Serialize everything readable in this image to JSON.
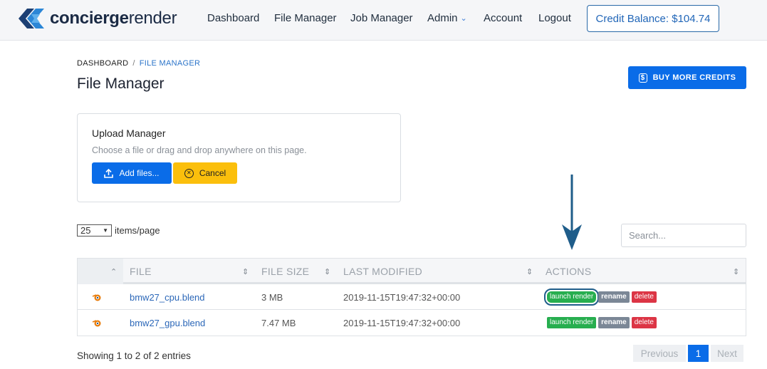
{
  "header": {
    "logo_bold": "concierge",
    "logo_light": "render",
    "nav": [
      "Dashboard",
      "File Manager",
      "Job Manager",
      "Admin",
      "Account",
      "Logout"
    ],
    "credit_balance": "Credit Balance: $104.74"
  },
  "breadcrumb": {
    "root": "DASHBOARD",
    "separator": "/",
    "current": "FILE MANAGER"
  },
  "page_title": "File Manager",
  "buy_button": {
    "icon": "$",
    "label": "BUY MORE CREDITS"
  },
  "upload": {
    "title": "Upload Manager",
    "hint": "Choose a file or drag and drop anywhere on this page.",
    "add_label": "Add files...",
    "cancel_label": "Cancel"
  },
  "table_controls": {
    "per_page_value": "25",
    "per_page_label": "items/page",
    "search_placeholder": "Search..."
  },
  "table": {
    "columns": [
      "FILE",
      "FILE SIZE",
      "LAST MODIFIED",
      "ACTIONS"
    ],
    "rows": [
      {
        "file": "bmw27_cpu.blend",
        "size": "3 MB",
        "modified": "2019-11-15T19:47:32+00:00"
      },
      {
        "file": "bmw27_gpu.blend",
        "size": "7.47 MB",
        "modified": "2019-11-15T19:47:32+00:00"
      }
    ],
    "actions": {
      "launch": "launch render",
      "rename": "rename",
      "delete": "delete"
    }
  },
  "footer": {
    "info": "Showing 1 to 2 of 2 entries",
    "prev": "Previous",
    "page": "1",
    "next": "Next"
  },
  "colors": {
    "accent": "#0a6ce8",
    "warning": "#fbbf0c",
    "success": "#27ae4f",
    "danger": "#dc3545",
    "annotation": "#1f5d8a"
  }
}
